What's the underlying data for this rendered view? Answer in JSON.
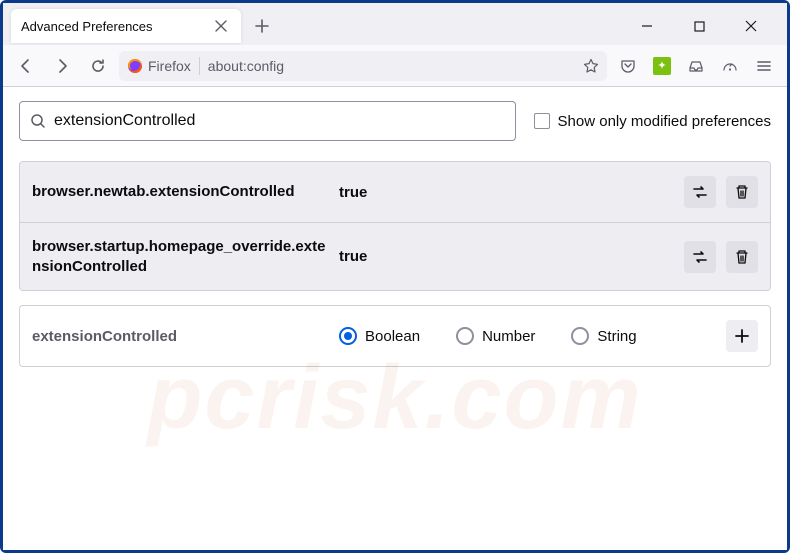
{
  "tab": {
    "title": "Advanced Preferences"
  },
  "urlbar": {
    "identity": "Firefox",
    "url": "about:config"
  },
  "search": {
    "value": "extensionControlled",
    "checkbox_label": "Show only modified preferences"
  },
  "prefs": [
    {
      "name": "browser.newtab.extensionControlled",
      "value": "true"
    },
    {
      "name": "browser.startup.homepage_override.extensionControlled",
      "value": "true"
    }
  ],
  "add_row": {
    "name": "extensionControlled",
    "options": [
      "Boolean",
      "Number",
      "String"
    ],
    "selected": 0
  },
  "watermark": "pcrisk.com"
}
